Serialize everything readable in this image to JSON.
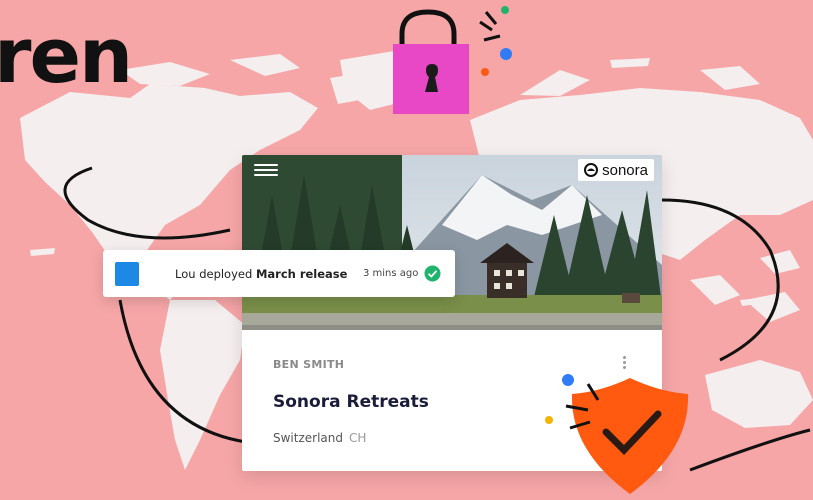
{
  "headline": {
    "text": "ren"
  },
  "card": {
    "brand_name": "sonora",
    "owner": "BEN SMITH",
    "title": "Sonora Retreats",
    "location_country": "Switzerland",
    "location_code": "CH"
  },
  "toast": {
    "actor": "Lou",
    "action": "deployed",
    "target": "March release",
    "time": "3 mins ago"
  },
  "colors": {
    "background": "#f6a6a7",
    "map": "#f4eeee",
    "lock": "#e847c6",
    "shield": "#ff5a0f",
    "toast_square": "#1e88e5",
    "check": "#1fb36b"
  },
  "icons": {
    "lock": "padlock-icon",
    "shield": "shield-check-icon",
    "menu": "hamburger-menu-icon",
    "kebab": "more-vertical-icon",
    "check": "check-circle-icon",
    "brand": "sonora-logo-icon"
  }
}
